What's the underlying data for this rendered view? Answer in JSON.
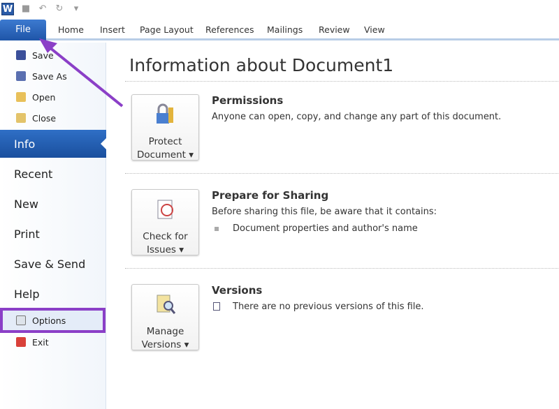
{
  "app": {
    "logo": "W",
    "tabs": [
      "File",
      "Home",
      "Insert",
      "Page Layout",
      "References",
      "Mailings",
      "Review",
      "View"
    ]
  },
  "sidebar": {
    "small_top": [
      {
        "label": "Save",
        "icon": "save-icon"
      },
      {
        "label": "Save As",
        "icon": "save-as-icon"
      },
      {
        "label": "Open",
        "icon": "open-folder-icon"
      },
      {
        "label": "Close",
        "icon": "close-folder-icon"
      }
    ],
    "big": [
      "Info",
      "Recent",
      "New",
      "Print",
      "Save & Send",
      "Help"
    ],
    "options": "Options",
    "exit": "Exit",
    "selected": "Info",
    "highlight_color": "#8b3fc7"
  },
  "main": {
    "title": "Information about Document1",
    "permissions": {
      "button": [
        "Protect",
        "Document"
      ],
      "heading": "Permissions",
      "text": "Anyone can open, copy, and change any part of this document."
    },
    "sharing": {
      "button": [
        "Check for",
        "Issues"
      ],
      "heading": "Prepare for Sharing",
      "text": "Before sharing this file, be aware that it contains:",
      "bullet": "Document properties and author's name"
    },
    "versions": {
      "button": [
        "Manage",
        "Versions"
      ],
      "heading": "Versions",
      "text": "There are no previous versions of this file."
    }
  },
  "colors": {
    "accent": "#1f55a8",
    "annotation": "#8b3fc7"
  }
}
